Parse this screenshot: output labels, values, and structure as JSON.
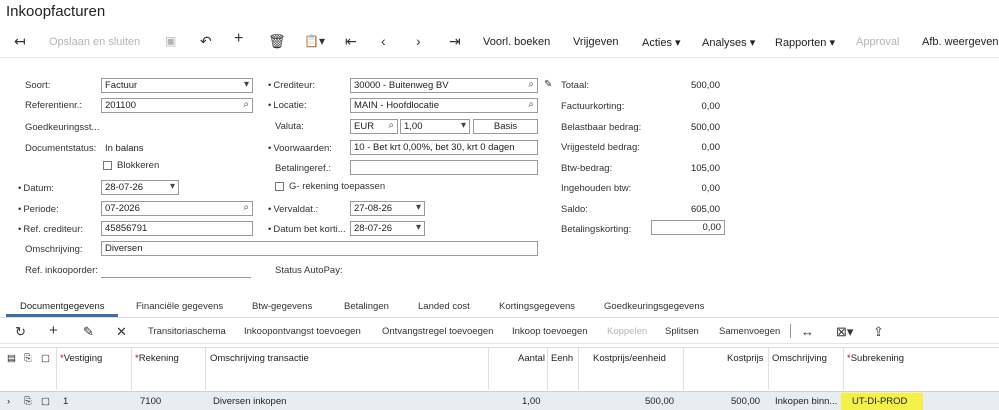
{
  "page": {
    "title": "Inkoopfacturen"
  },
  "toolbar": {
    "save_close": "Opslaan en sluiten",
    "post": "Voorl. boeken",
    "release": "Vrijgeven",
    "actions": "Acties",
    "analyses": "Analyses",
    "reports": "Rapporten",
    "approval": "Approval",
    "display": "Afb. weergeven"
  },
  "form": {
    "soort_label": "Soort:",
    "soort_value": "Factuur",
    "ref_label": "Referentienr.:",
    "ref_value": "201100",
    "goedk_label": "Goedkeuringsst...",
    "docstatus_label": "Documentstatus:",
    "docstatus_value": "In balans",
    "block_label": "Blokkeren",
    "datum_label": "Datum:",
    "datum_value": "28-07-26",
    "periode_label": "Periode:",
    "periode_value": "07-2026",
    "refcred_label": "Ref. crediteur:",
    "refcred_value": "45856791",
    "omschr_label": "Omschrijving:",
    "omschr_value": "Diversen",
    "refinkoop_label": "Ref. inkooporder:",
    "cred_label": "Crediteur:",
    "cred_value": "30000 - Buitenweg BV",
    "locatie_label": "Locatie:",
    "locatie_value": "MAIN - Hoofdlocatie",
    "valuta_label": "Valuta:",
    "valuta_value": "EUR",
    "valuta_rate": "1,00",
    "basis_button": "Basis",
    "voorw_label": "Voorwaarden:",
    "voorw_value": "10 - Bet krt 0,00%, bet 30, krt 0 dagen",
    "betref_label": "Betalingeref.:",
    "grek_label": "G- rekening toepassen",
    "verval_label": "Vervaldat.:",
    "verval_value": "27-08-26",
    "datumkort_label": "Datum bet korti...",
    "datumkort_value": "28-07-26",
    "autopay_label": "Status AutoPay:"
  },
  "totals": {
    "totaal_label": "Totaal:",
    "totaal_value": "500,00",
    "korting_label": "Factuurkorting:",
    "korting_value": "0,00",
    "belast_label": "Belastbaar bedrag:",
    "belast_value": "500,00",
    "vrij_label": "Vrijgesteld bedrag:",
    "vrij_value": "0,00",
    "btw_label": "Btw-bedrag:",
    "btw_value": "105,00",
    "ingeh_label": "Ingehouden btw:",
    "ingeh_value": "0,00",
    "saldo_label": "Saldo:",
    "saldo_value": "605,00",
    "betkort_label": "Betalingskorting:",
    "betkort_value": "0,00"
  },
  "tabs": [
    "Documentgegevens",
    "Financiële gegevens",
    "Btw-gegevens",
    "Betalingen",
    "Landed cost",
    "Kortingsgegevens",
    "Goedkeuringsgegevens"
  ],
  "gridbar": {
    "transit": "Transitoriaschema",
    "inkoopontv": "Inkoopontvangst toevoegen",
    "ontvregel": "Ontvangstregel toevoegen",
    "inkoop": "Inkoop toevoegen",
    "koppelen": "Koppelen",
    "splitsen": "Splitsen",
    "samenvoegen": "Samenvoegen"
  },
  "grid": {
    "headers": {
      "vestiging": "Vestiging",
      "rekening": "Rekening",
      "omschr": "Omschrijving transactie",
      "aantal": "Aantal",
      "eenh": "Eenh",
      "kostprijs_eenh": "Kostprijs/eenheid",
      "kostprijs": "Kostprijs",
      "omschrijving": "Omschrijving",
      "subrek": "Subrekening"
    },
    "row": {
      "vestiging": "1",
      "rekening": "7100",
      "omschr": "Diversen inkopen",
      "aantal": "1,00",
      "kostprijs_eenh": "500,00",
      "kostprijs": "500,00",
      "omschrijving": "Inkopen binn...",
      "subrek": "UT-DI-PROD"
    },
    "highlight_color": "#f4f04a"
  }
}
